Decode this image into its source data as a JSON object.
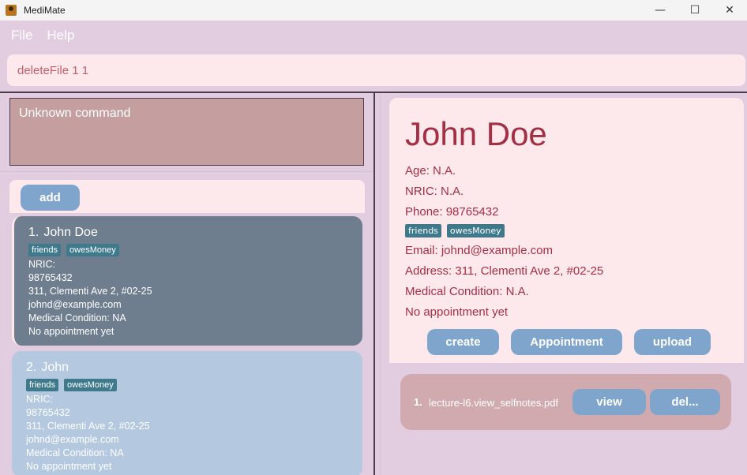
{
  "window": {
    "title": "MediMate",
    "controls": {
      "minimize": "—",
      "maximize": "☐",
      "close": "✕"
    }
  },
  "menu": [
    "File",
    "Help"
  ],
  "command_input": {
    "value": "deleteFile 1 1"
  },
  "result_display": {
    "text": "Unknown command"
  },
  "list_panel": {
    "add_label": "add",
    "persons": [
      {
        "index": "1.",
        "name": "John Doe",
        "tags": [
          "friends",
          "owesMoney"
        ],
        "lines": [
          "NRIC:",
          "98765432",
          "311, Clementi Ave 2, #02-25",
          "johnd@example.com",
          "Medical Condition: NA",
          "No appointment yet"
        ]
      },
      {
        "index": "2.",
        "name": "John",
        "tags": [
          "friends",
          "owesMoney"
        ],
        "lines": [
          "NRIC:",
          "98765432",
          "311, Clementi Ave 2, #02-25",
          "johnd@example.com",
          "Medical Condition: NA",
          "No appointment yet"
        ]
      }
    ]
  },
  "detail_panel": {
    "name": "John Doe",
    "age": "Age: N.A.",
    "nric": "NRIC: N.A.",
    "phone": "Phone: 98765432",
    "tags": [
      "friends",
      "owesMoney"
    ],
    "email": "Email: johnd@example.com",
    "address": "Address: 311, Clementi Ave 2, #02-25",
    "medical": "Medical Condition: N.A.",
    "appointment": "No appointment yet",
    "buttons": {
      "create": "create",
      "appointment": "Appointment",
      "upload": "upload"
    },
    "files": [
      {
        "index": "1.",
        "name": "lecture-l6.view_selfnotes.pdf",
        "view_label": "view",
        "delete_label": "del..."
      }
    ]
  },
  "colors": {
    "background": "#e2cde0",
    "panel": "#fde9ec",
    "button": "#7fa5cd",
    "selected_card": "#6f7e8f",
    "card": "#b4c8e0",
    "tag": "#3f7a8c",
    "detail_text": "#a32f44"
  }
}
